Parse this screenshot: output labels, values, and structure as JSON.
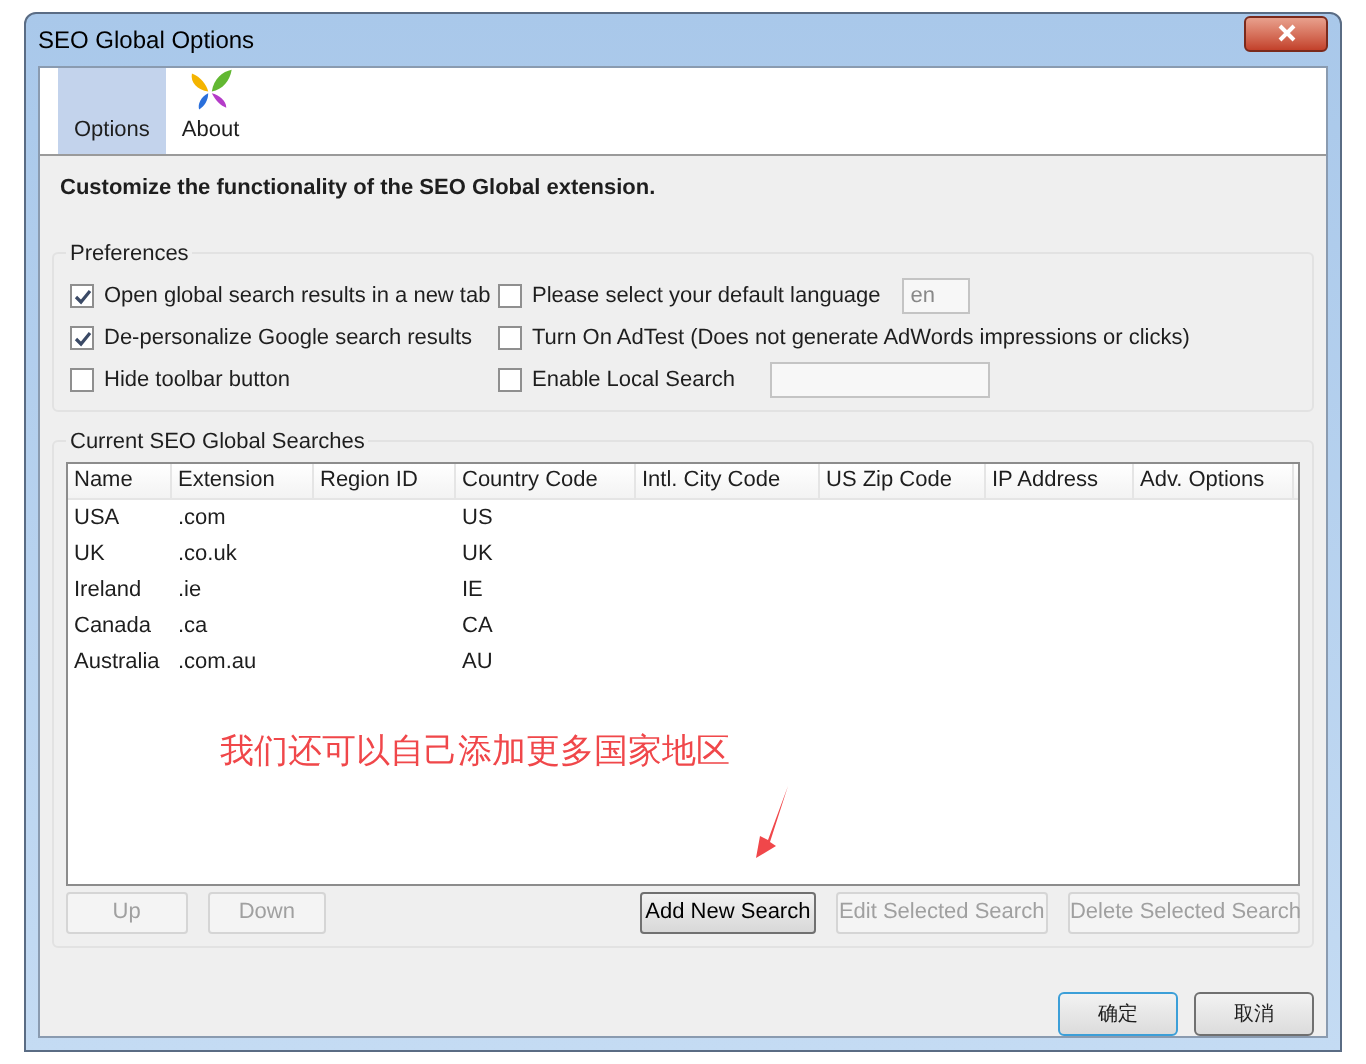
{
  "window": {
    "title": "SEO Global Options"
  },
  "tabs": [
    {
      "label": "Options",
      "selected": true,
      "kind": "plain"
    },
    {
      "label": "About",
      "selected": false,
      "kind": "logo"
    }
  ],
  "heading": "Customize the functionality of the SEO Global extension.",
  "preferences": {
    "title": "Preferences",
    "left": [
      {
        "label": "Open global search results in a new tab",
        "checked": true
      },
      {
        "label": "De-personalize Google search results",
        "checked": true
      },
      {
        "label": "Hide toolbar button",
        "checked": false
      }
    ],
    "right": [
      {
        "label": "Please select your default language",
        "checked": false,
        "field": "en"
      },
      {
        "label": "Turn On AdTest (Does not generate AdWords impressions or clicks)",
        "checked": false
      },
      {
        "label": "Enable Local Search",
        "checked": false,
        "has_field": true
      }
    ]
  },
  "searches": {
    "title": "Current SEO Global Searches",
    "columns": [
      "Name",
      "Extension",
      "Region ID",
      "Country Code",
      "Intl. City Code",
      "US Zip Code",
      "IP Address",
      "Adv. Options"
    ],
    "rows": [
      [
        "USA",
        ".com",
        "",
        "US"
      ],
      [
        "UK",
        ".co.uk",
        "",
        "UK"
      ],
      [
        "Ireland",
        ".ie",
        "",
        "IE"
      ],
      [
        "Canada",
        ".ca",
        "",
        "CA"
      ],
      [
        "Australia",
        ".com.au",
        "",
        "AU"
      ]
    ],
    "buttons": [
      {
        "label": "Up",
        "disabled": true
      },
      {
        "label": "Down",
        "disabled": true
      },
      {
        "label": "Add New Search",
        "disabled": false
      },
      {
        "label": "Edit Selected Search",
        "disabled": true
      },
      {
        "label": "Delete Selected Search",
        "disabled": true
      }
    ]
  },
  "annotation": "我们还可以自己添加更多国家地区",
  "dialog_buttons": [
    {
      "label": "确定",
      "default": true
    },
    {
      "label": "取消",
      "default": false
    }
  ]
}
